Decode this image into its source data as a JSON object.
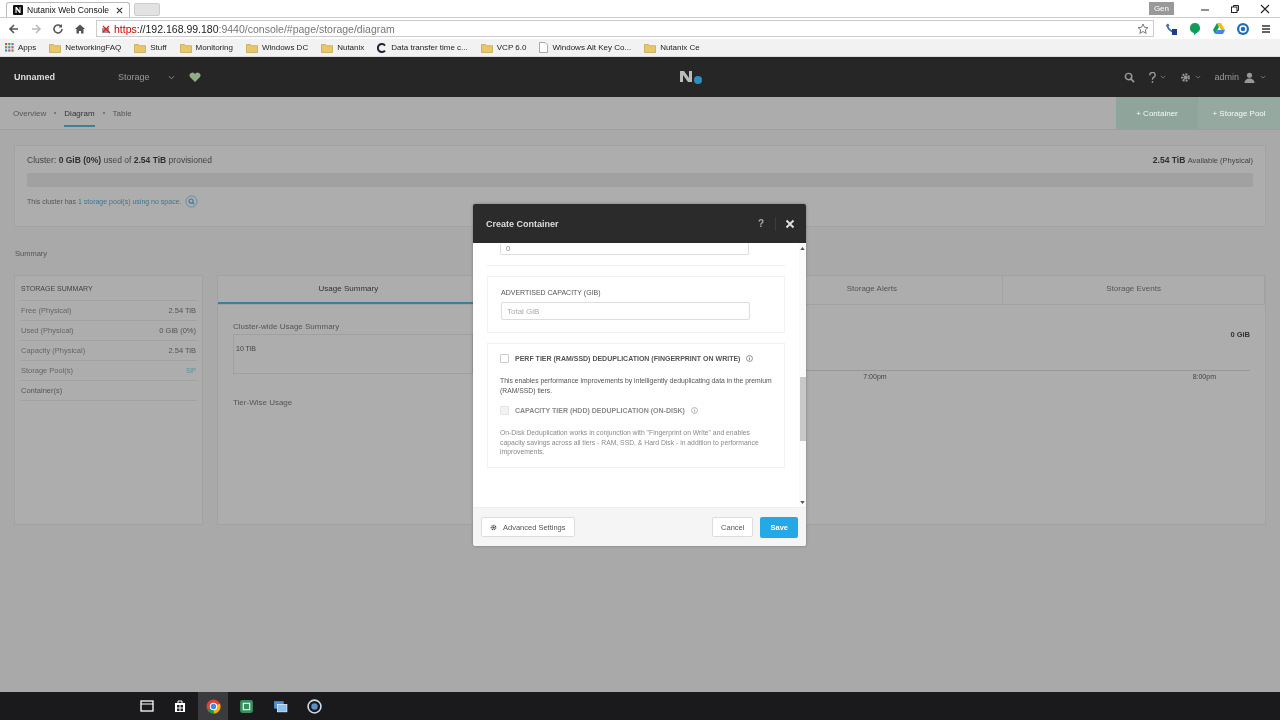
{
  "browser": {
    "tab_title": "Nutanix Web Console",
    "url_scheme": "https",
    "url_host": "://192.168.99.180",
    "url_rest": ":9440/console/#page/storage/diagram",
    "user_badge": "Gen",
    "bookmarks": [
      {
        "label": "Apps",
        "kind": "apps"
      },
      {
        "label": "NetworkingFAQ",
        "kind": "folder"
      },
      {
        "label": "Stuff",
        "kind": "folder"
      },
      {
        "label": "Monitoring",
        "kind": "folder"
      },
      {
        "label": "Windows DC",
        "kind": "folder"
      },
      {
        "label": "Nutanix",
        "kind": "folder"
      },
      {
        "label": "Data transfer time c...",
        "kind": "site"
      },
      {
        "label": "VCP 6.0",
        "kind": "folder"
      },
      {
        "label": "Windows Alt Key Co...",
        "kind": "page"
      },
      {
        "label": "Nutanix Ce",
        "kind": "folder"
      }
    ]
  },
  "header": {
    "cluster_name": "Unnamed",
    "section": "Storage",
    "user": "admin"
  },
  "subnav": {
    "views": [
      {
        "label": "Overview",
        "selected": false
      },
      {
        "label": "Diagram",
        "selected": true
      },
      {
        "label": "Table",
        "selected": false
      }
    ],
    "actions": [
      "+ Container",
      "+ Storage Pool"
    ]
  },
  "cluster": {
    "label": "Cluster:",
    "used": "0 GiB (0%)",
    "used_of": "used of",
    "provisioned": "2.54 TiB",
    "provisioned_label": "provisioned",
    "available": "2.54 TiB",
    "available_label": "Available (Physical)",
    "note_prefix": "This cluster has",
    "note_link": "1 storage pool(s) using no space."
  },
  "summary_title": "Summary",
  "storage_summary": {
    "title": "STORAGE SUMMARY",
    "rows": [
      {
        "label": "Free (Physical)",
        "value": "2.54 TiB",
        "kind": "text"
      },
      {
        "label": "Used (Physical)",
        "value": "0 GiB (0%)",
        "kind": "text"
      },
      {
        "label": "Capacity (Physical)",
        "value": "2.54 TiB",
        "kind": "text"
      },
      {
        "label": "Storage Pool(s)",
        "value": "SP",
        "kind": "link"
      },
      {
        "label": "Container(s)"
      }
    ]
  },
  "tabs": [
    {
      "label": "Usage Summary",
      "selected": true
    },
    {
      "label": "Storage Alerts",
      "selected": false
    },
    {
      "label": "Storage Events",
      "selected": false
    }
  ],
  "usage": {
    "cluster_title": "Cluster-wide Usage Summary",
    "axis_max": "10 TiB",
    "current": "0 GiB",
    "times": [
      "7:00pm",
      "8:00pm"
    ],
    "tier_title": "Tier-Wise Usage"
  },
  "dialog": {
    "title": "Create Container",
    "help": "?",
    "top_field_value": "0",
    "capacity_label": "ADVERTISED CAPACITY (GIB)",
    "capacity_placeholder": "Total GiB",
    "options": [
      {
        "label": "PERF TIER (RAM/SSD) DEDUPLICATION (FINGERPRINT ON WRITE)",
        "checked": false,
        "disabled": false,
        "description": "This enables performance improvements by intelligently deduplicating data in the premium (RAM/SSD) tiers."
      },
      {
        "label": "CAPACITY TIER (HDD) DEDUPLICATION (ON-DISK)",
        "checked": false,
        "disabled": true,
        "description": "On-Disk Deduplication works in conjunction with \"Fingerprint on Write\" and enables capacity savings across all tiers - RAM, SSD, & Hard Disk - in addition to performance improvements."
      }
    ],
    "advanced": "Advanced Settings",
    "cancel": "Cancel",
    "save": "Save"
  }
}
